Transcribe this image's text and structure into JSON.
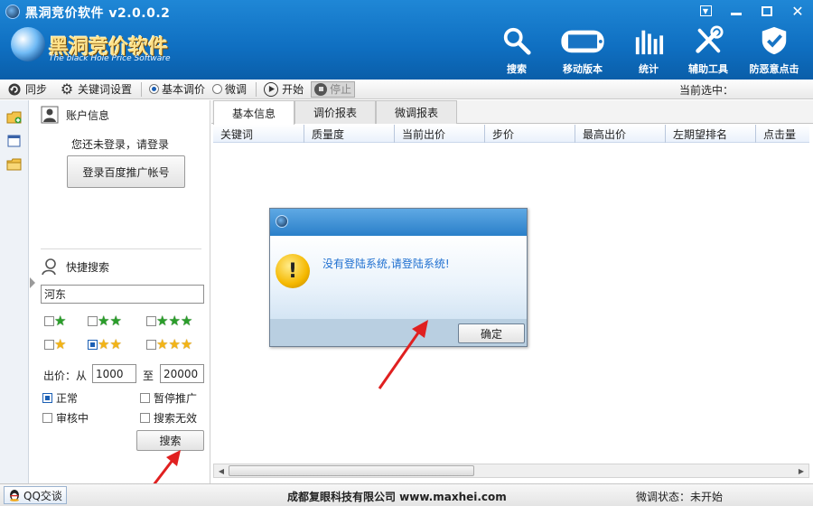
{
  "window": {
    "title": "黑洞竞价软件 v2.0.0.2",
    "logo_main": "黑洞竞价软件",
    "logo_sub": "The black Hole Price Software"
  },
  "tools": [
    {
      "label": "搜索",
      "icon": "search-icon"
    },
    {
      "label": "移动版本",
      "icon": "mobile-icon"
    },
    {
      "label": "统计",
      "icon": "stats-bars-icon"
    },
    {
      "label": "辅助工具",
      "icon": "tools-icon"
    },
    {
      "label": "防恶意点击",
      "icon": "shield-check-icon"
    }
  ],
  "toolbar": {
    "sync": "同步",
    "keyword_settings": "关键词设置",
    "basic_adjust": "基本调价",
    "fine_adjust": "微调",
    "start": "开始",
    "stop": "停止",
    "current_selected": "当前选中："
  },
  "account": {
    "heading": "账户信息",
    "not_logged": "您还未登录，请登录",
    "login_button": "登录百度推广帐号"
  },
  "quick_search": {
    "heading": "快捷搜索",
    "query": "河东",
    "bid_label": "出价：从",
    "bid_from": "1000",
    "to_label": "至",
    "bid_to": "20000",
    "status_normal": "正常",
    "status_paused": "暂停推广",
    "status_review": "审核中",
    "status_invalid": "搜索无效",
    "search_button": "搜索"
  },
  "tabs": [
    "基本信息",
    "调价报表",
    "微调报表"
  ],
  "columns": [
    "关键词",
    "质量度",
    "当前出价",
    "步价",
    "最高出价",
    "左期望排名",
    "点击量"
  ],
  "dialog": {
    "message": "没有登陆系统,请登陆系统!",
    "ok": "确定"
  },
  "status": {
    "qq": "QQ交谈",
    "company": "成都复眼科技有限公司 www.maxhei.com",
    "tweak_status": "微调状态：未开始"
  },
  "colors": {
    "header_blue": "#0f6fc1",
    "dialog_text": "#1e6fd0",
    "arrow_red": "#e02020"
  }
}
